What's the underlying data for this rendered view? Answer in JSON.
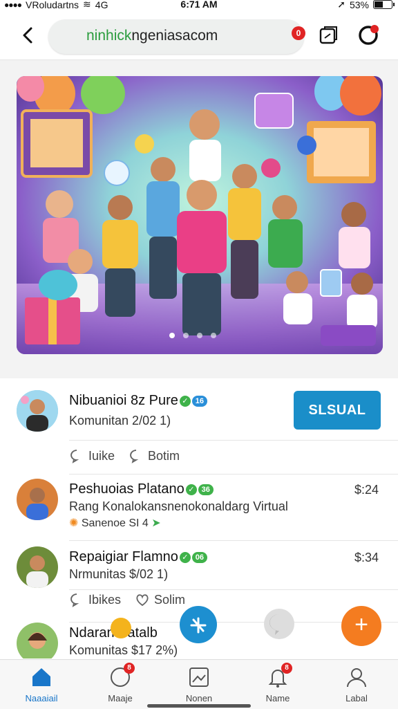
{
  "status": {
    "carrier": "VRoludartns",
    "network": "4G",
    "time": "6:71 AM",
    "battery": "53%",
    "dots": "●●●●"
  },
  "browser": {
    "url": "ninhickngeniasacom",
    "url_prefix": "ninhick",
    "url_rest": "ngeniasacom",
    "badge": "0"
  },
  "hero": {
    "icons": [
      "balloon-icon",
      "chat-bubble-icon",
      "game-controller-icon"
    ],
    "active_dot": 0
  },
  "posts": [
    {
      "name": "Nibuanioi 8z Pure",
      "badge": "16",
      "sub": "Komunitan 2/02 1)",
      "button": "SLSUAL",
      "like": "Iuike",
      "comment": "Botim"
    },
    {
      "name": "Peshuoias Platano",
      "badge": "36",
      "sub": "Rang Konalokansnenokonaldarg Virtual",
      "sub2": "Sanenoe SI 4",
      "time": "$:24"
    },
    {
      "name": "Repaigiar Flamno",
      "badge": "06",
      "sub": "Nrmunitas $/02 1)",
      "time": "$:34",
      "like": "Ibikes",
      "comment": "Solim"
    },
    {
      "name": "Ndaran Batalb",
      "sub": "Komunitas $17 2%)"
    }
  ],
  "nav": [
    {
      "label": "Naaaiail",
      "icon": "home-icon"
    },
    {
      "label": "Maaje",
      "icon": "chat-icon",
      "badge": "8"
    },
    {
      "label": "Nonen",
      "icon": "picture-icon"
    },
    {
      "label": "Name",
      "icon": "bell-icon",
      "badge": "8"
    },
    {
      "label": "Labal",
      "icon": "profile-icon"
    }
  ],
  "colors": {
    "accent": "#1a8ec9",
    "orange": "#f47c20",
    "active": "#1976c9"
  }
}
